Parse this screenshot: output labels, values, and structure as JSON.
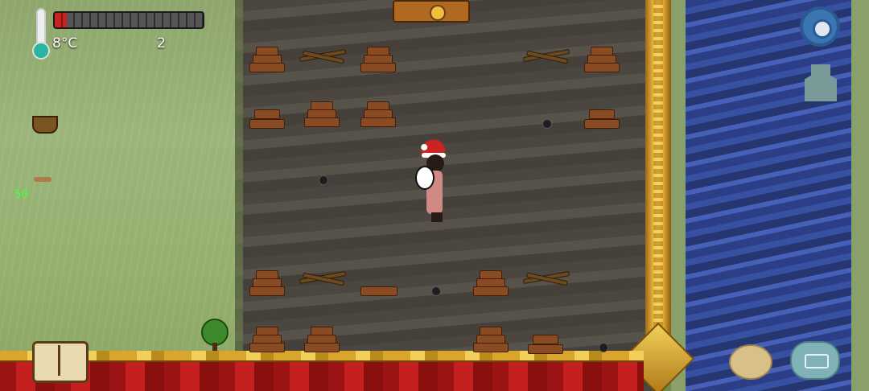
{
  "hud": {
    "temperature": "8°C",
    "count": "2",
    "health_fraction": 0.08
  },
  "world": {
    "debug_label": "50",
    "icons": [
      "thermometer-icon",
      "gear-icon",
      "map-icon",
      "book-icon",
      "potato-emote-icon",
      "keyboard-icon"
    ]
  },
  "colors": {
    "health_fill": "#c82222",
    "health_empty": "#555555",
    "water": "#2b3e86",
    "dirt": "#4b4740",
    "grass": "#8ea66c",
    "gold_trim": "#e6b33a",
    "curtain": "#c42020"
  }
}
